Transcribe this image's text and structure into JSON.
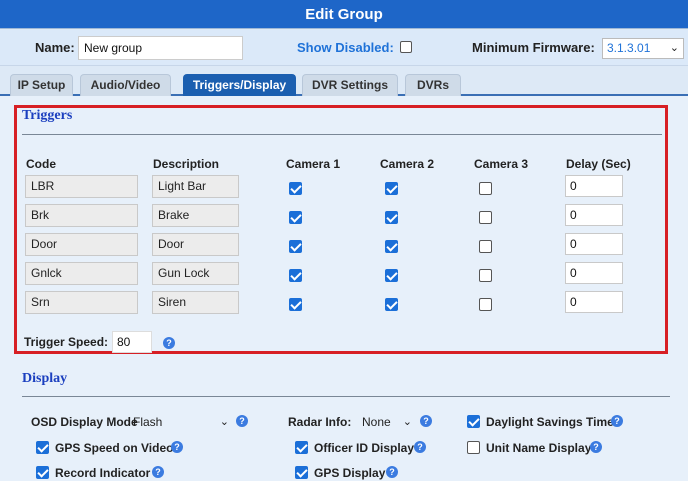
{
  "window": {
    "title": "Edit Group"
  },
  "header": {
    "name_label": "Name:",
    "name_value": "New group",
    "show_disabled_label": "Show Disabled:",
    "show_disabled_checked": false,
    "min_firmware_label": "Minimum Firmware:",
    "min_firmware_value": "3.1.3.01"
  },
  "tabs": [
    {
      "label": "IP Setup",
      "active": false
    },
    {
      "label": "Audio/Video",
      "active": false
    },
    {
      "label": "Triggers/Display",
      "active": true
    },
    {
      "label": "DVR Settings",
      "active": false
    },
    {
      "label": "DVRs",
      "active": false
    }
  ],
  "triggers": {
    "section_title": "Triggers",
    "columns": [
      "Code",
      "Description",
      "Camera 1",
      "Camera 2",
      "Camera 3",
      "Delay (Sec)"
    ],
    "rows": [
      {
        "code": "LBR",
        "description": "Light Bar",
        "cam1": true,
        "cam2": true,
        "cam3": false,
        "delay": "0"
      },
      {
        "code": "Brk",
        "description": "Brake",
        "cam1": true,
        "cam2": true,
        "cam3": false,
        "delay": "0"
      },
      {
        "code": "Door",
        "description": "Door",
        "cam1": true,
        "cam2": true,
        "cam3": false,
        "delay": "0"
      },
      {
        "code": "Gnlck",
        "description": "Gun Lock",
        "cam1": true,
        "cam2": true,
        "cam3": false,
        "delay": "0"
      },
      {
        "code": "Srn",
        "description": "Siren",
        "cam1": true,
        "cam2": true,
        "cam3": false,
        "delay": "0"
      }
    ],
    "trigger_speed_label": "Trigger Speed:",
    "trigger_speed_value": "80"
  },
  "display": {
    "section_title": "Display",
    "osd_mode_label": "OSD Display Mode",
    "osd_mode_value": "Flash",
    "radar_info_label": "Radar Info:",
    "radar_info_value": "None",
    "daylight_savings_label": "Daylight Savings Time",
    "daylight_savings_checked": true,
    "gps_speed_label": "GPS Speed on Video",
    "gps_speed_checked": true,
    "officer_id_label": "Officer ID Display",
    "officer_id_checked": true,
    "unit_name_label": "Unit Name Display",
    "unit_name_checked": false,
    "record_indicator_label": "Record Indicator",
    "record_indicator_checked": true,
    "gps_display_label": "GPS Display",
    "gps_display_checked": true
  },
  "colors": {
    "title_bar": "#1e66c8",
    "active_tab": "#1b5fb0",
    "checkbox": "#1b6fd8",
    "highlight_box": "#d71f24",
    "section_title": "#1b3fbf"
  },
  "icons": {
    "help": "help-icon",
    "dropdown": "chevron-down-icon"
  }
}
